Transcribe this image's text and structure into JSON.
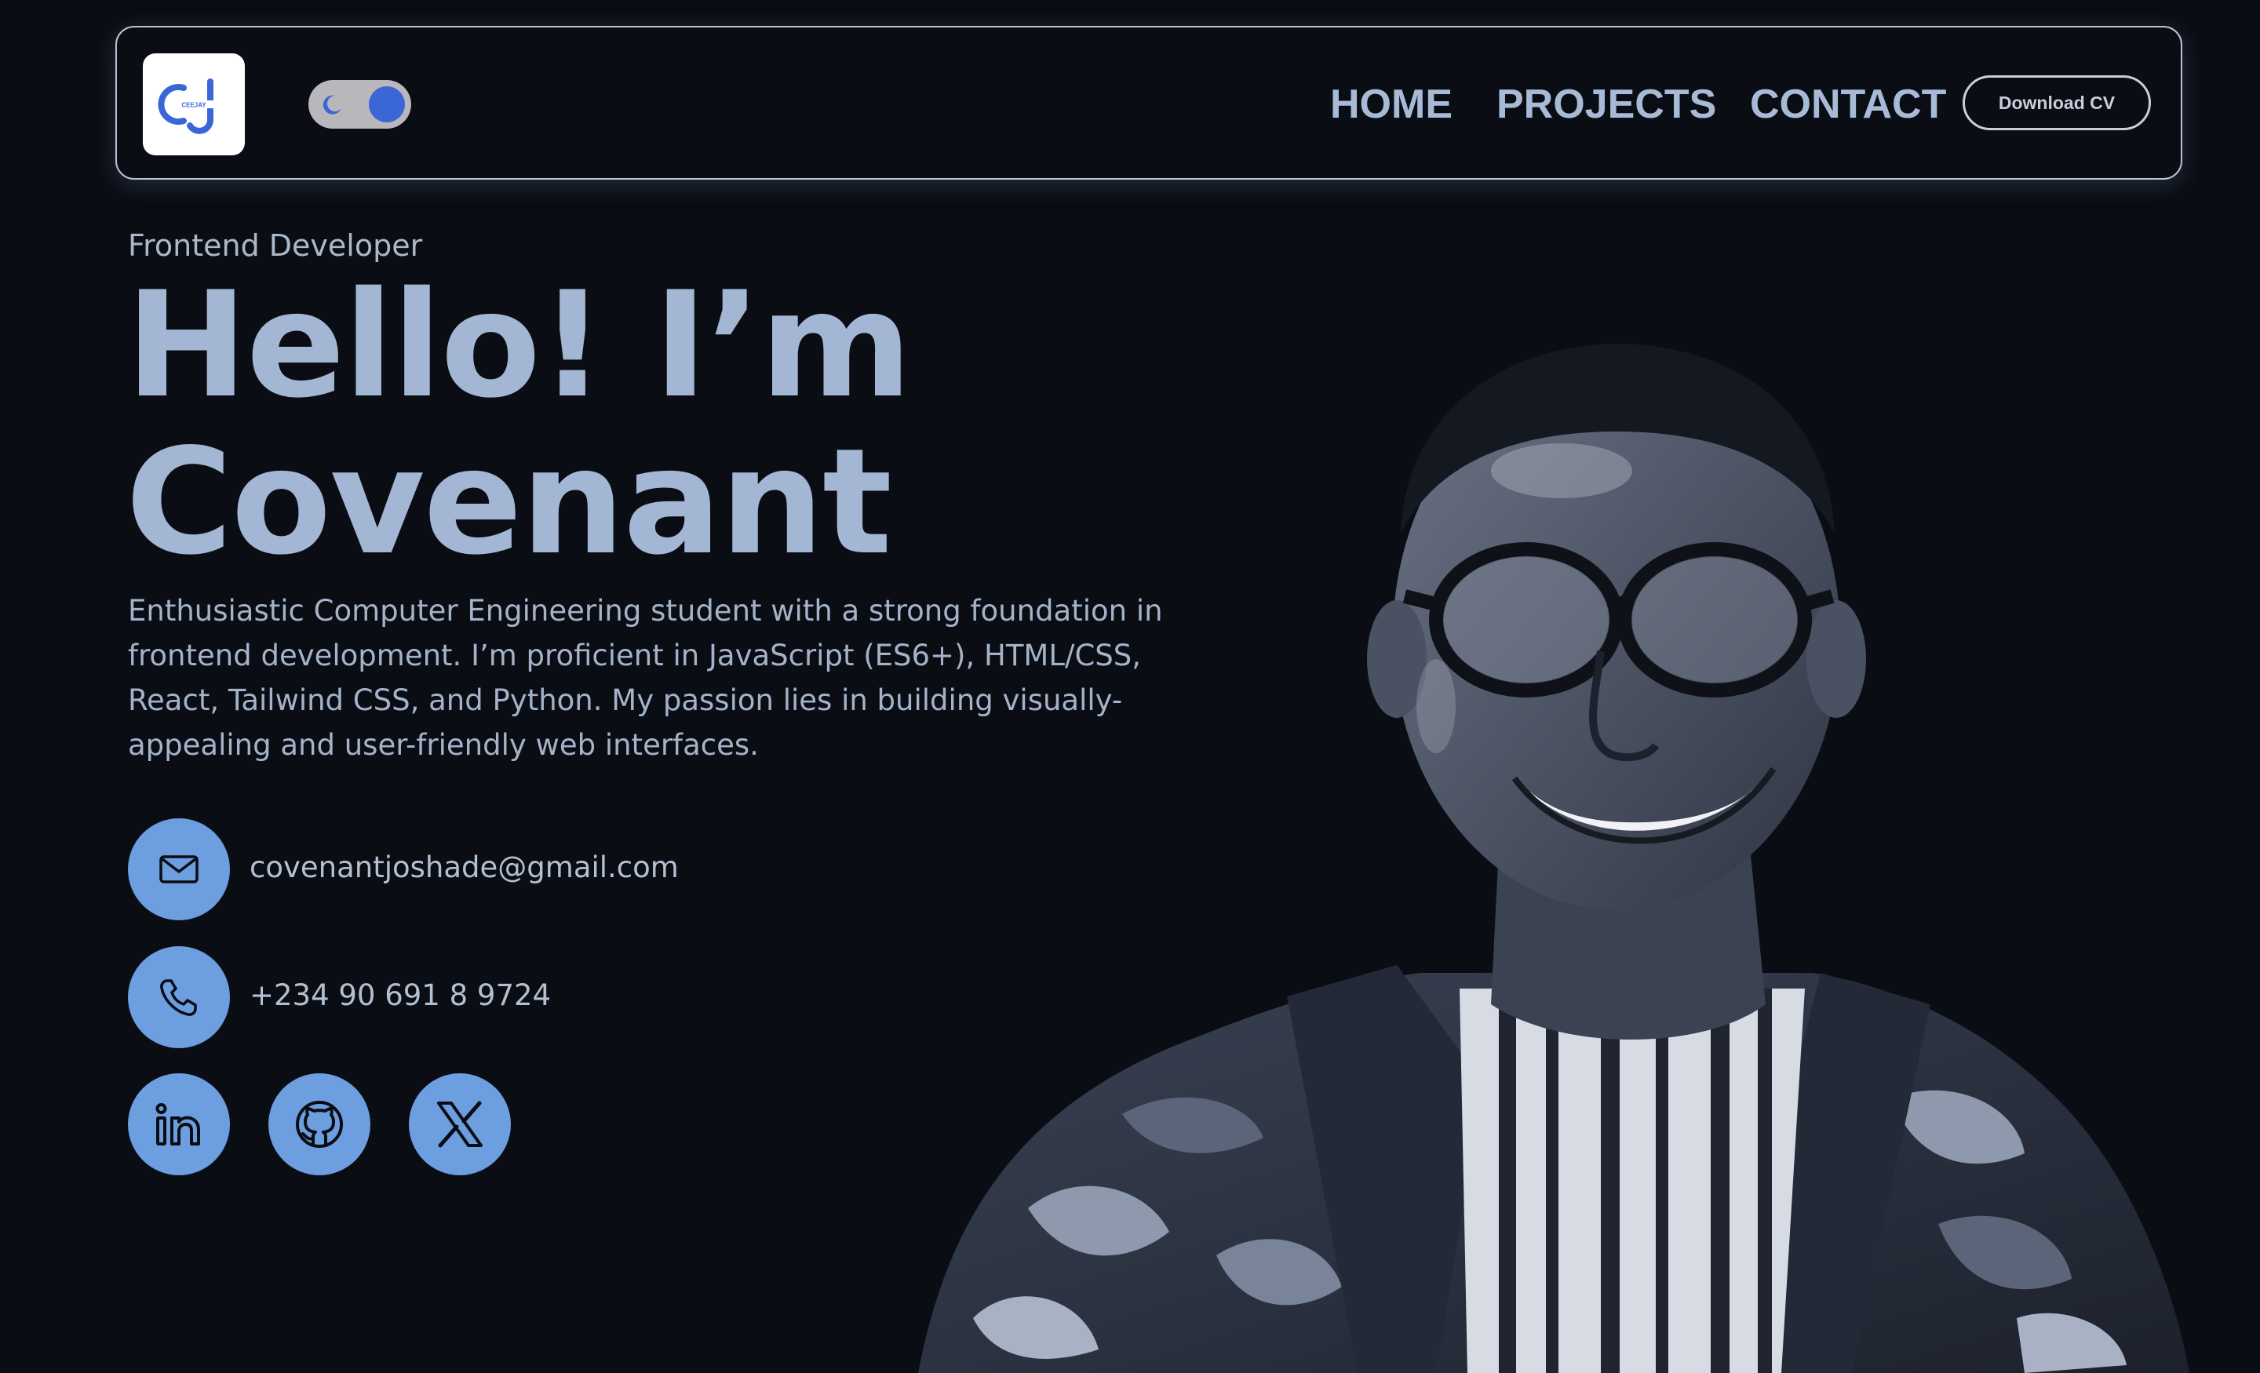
{
  "nav": {
    "logo_text": "CEEJAY",
    "logo_letters": "CJ",
    "links": [
      "HOME",
      "PROJECTS",
      "CONTACT"
    ],
    "cv_button": "Download CV",
    "theme_toggle_state": "dark"
  },
  "hero": {
    "role": "Frontend Developer",
    "greeting": "Hello! I’m",
    "name": "Covenant",
    "bio": "Enthusiastic Computer Engineering student with a strong foundation in frontend development. I’m proficient in JavaScript (ES6+), HTML/CSS, React, Tailwind CSS, and Python. My passion lies in building visually-appealing and user-friendly web interfaces."
  },
  "contact": {
    "email": "covenantjoshade@gmail.com",
    "phone": "+234 90 691 8 9724",
    "email_icon": "mail-icon",
    "phone_icon": "phone-icon"
  },
  "social": [
    {
      "icon": "linkedin-icon"
    },
    {
      "icon": "github-icon"
    },
    {
      "icon": "x-twitter-icon"
    }
  ],
  "colors": {
    "background": "#0a0d14",
    "accent": "#6c9ee0",
    "text": "#a3b6d3",
    "toggle_knob": "#3b67d6"
  }
}
